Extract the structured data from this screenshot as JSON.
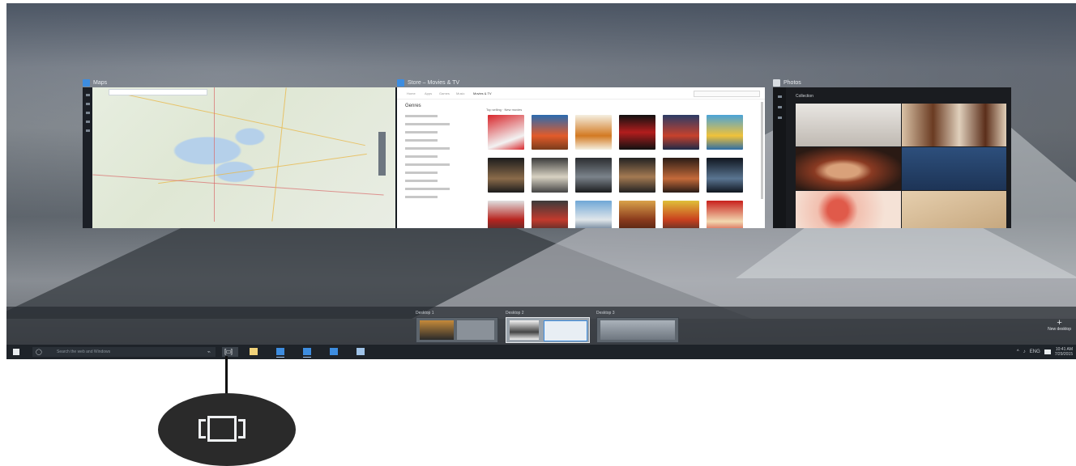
{
  "windows": {
    "maps": {
      "title": "Maps"
    },
    "store": {
      "title": "Store – Movies & TV",
      "nav": [
        "Home",
        "Apps",
        "Games",
        "Music",
        "Movies & TV"
      ],
      "search_placeholder": "Search",
      "sidebar_heading": "Genres",
      "section_label": "Top selling · New movies"
    },
    "photos": {
      "title": "Photos",
      "header": "Collection"
    }
  },
  "desktops": [
    {
      "label": "Desktop 1"
    },
    {
      "label": "Desktop 2",
      "active": true
    },
    {
      "label": "Desktop 3"
    }
  ],
  "new_desktop": {
    "plus": "+",
    "label": "New desktop"
  },
  "taskbar": {
    "search_placeholder": "Search the web and Windows",
    "search_icon": "circle-icon",
    "mic_icon": "mic-icon",
    "task_view_glyph": "[▭]",
    "tray_icons": [
      "^",
      "♪",
      "ENG"
    ],
    "time": "10:41 AM",
    "date": "7/29/2015"
  },
  "callout": {
    "label": "task-view-icon-magnified"
  },
  "colors": {
    "accent": "#3d8de0",
    "taskbar": "#1e2329"
  }
}
